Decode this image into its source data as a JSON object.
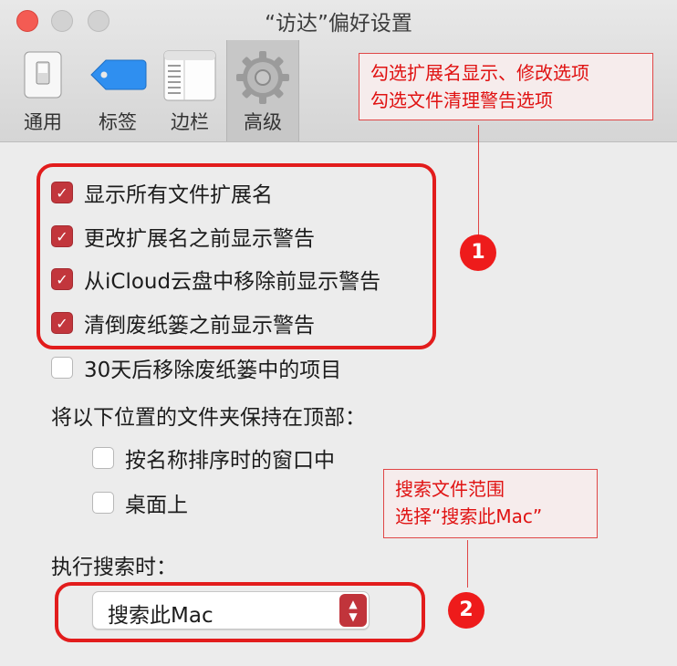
{
  "window": {
    "title": "“访达”偏好设置"
  },
  "tabs": [
    {
      "label": "通用",
      "icon": "switch-icon"
    },
    {
      "label": "标签",
      "icon": "tag-icon"
    },
    {
      "label": "边栏",
      "icon": "sidebar-icon"
    },
    {
      "label": "高级",
      "icon": "gear-icon",
      "active": true
    }
  ],
  "options": {
    "show_extensions": {
      "label": "显示所有文件扩展名",
      "checked": true
    },
    "warn_extension_change": {
      "label": "更改扩展名之前显示警告",
      "checked": true
    },
    "warn_icloud_remove": {
      "label": "从iCloud云盘中移除前显示警告",
      "checked": true
    },
    "warn_empty_trash": {
      "label": "清倒废纸篓之前显示警告",
      "checked": true
    },
    "remove_trash_30_days": {
      "label": "30天后移除废纸篓中的项目",
      "checked": false
    }
  },
  "folders_on_top": {
    "heading": "将以下位置的文件夹保持在顶部：",
    "windows_sorted": {
      "label": "按名称排序时的窗口中",
      "checked": false
    },
    "desktop": {
      "label": "桌面上",
      "checked": false
    }
  },
  "search": {
    "heading": "执行搜索时：",
    "selected": "搜索此Mac"
  },
  "annotations": {
    "note1": {
      "line1": "勾选扩展名显示、修改选项",
      "line2": "勾选文件清理警告选项"
    },
    "note2": {
      "line1": "搜索文件范围",
      "line2": "选择“搜索此Mac”"
    },
    "badge1": "1",
    "badge2": "2"
  },
  "colors": {
    "accent": "#c2363c",
    "annotation": "#e21c1c"
  },
  "glyphs": {
    "check": "✓",
    "up": "▲",
    "down": "▼"
  }
}
